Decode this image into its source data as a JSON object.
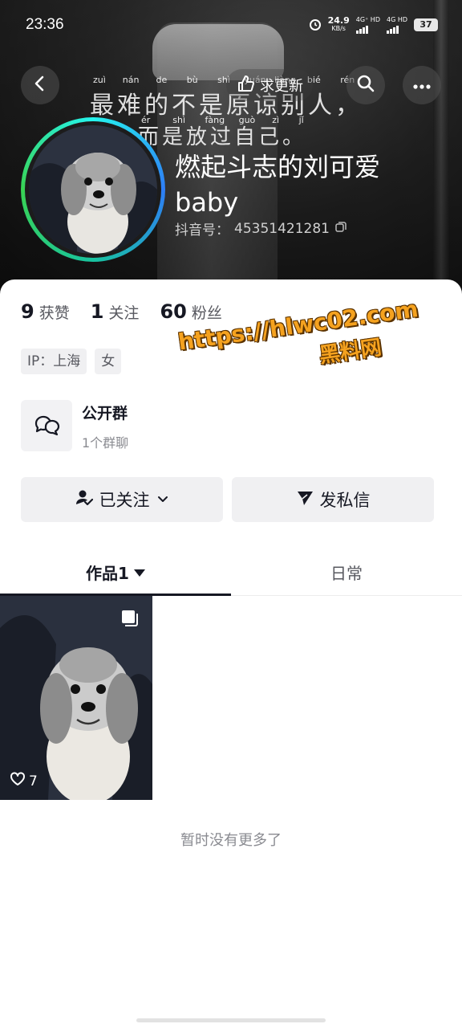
{
  "status_bar": {
    "time": "23:36",
    "network_speed": "24.9",
    "network_unit": "KB/s",
    "signal_1": "4G⁺ HD",
    "signal_2": "4G HD",
    "battery": "37"
  },
  "header": {
    "update_label": "求更新",
    "cover_quote": {
      "line1_pinyin": [
        "zuì",
        "nán",
        "de",
        "bù",
        "shì",
        "yuán",
        "liàng",
        "bié",
        "rén"
      ],
      "line1_text": "最难的不是原谅别人，",
      "line2_pinyin": [
        "ér",
        "shì",
        "fàng",
        "guò",
        "zì",
        "jǐ"
      ],
      "line2_text": "而是放过自己。"
    },
    "nickname": "燃起斗志的刘可爱baby",
    "douyin_id_label": "抖音号：",
    "douyin_id": "45351421281"
  },
  "stats": [
    {
      "num": "9",
      "label": "获赞"
    },
    {
      "num": "1",
      "label": "关注"
    },
    {
      "num": "60",
      "label": "粉丝"
    }
  ],
  "tags": [
    "IP：上海",
    "女"
  ],
  "group": {
    "title": "公开群",
    "subtitle": "1个群聊"
  },
  "actions": {
    "follow_label": "已关注",
    "message_label": "发私信"
  },
  "tabs": {
    "works": "作品1",
    "daily": "日常"
  },
  "works": [
    {
      "likes": "7"
    }
  ],
  "footer_text": "暂时没有更多了",
  "watermark": {
    "line1": "https://hlwc02.com",
    "line2": "黑料网"
  },
  "colors": {
    "accent_ring": "#25f4ee",
    "watermark": "#f5a21f"
  }
}
